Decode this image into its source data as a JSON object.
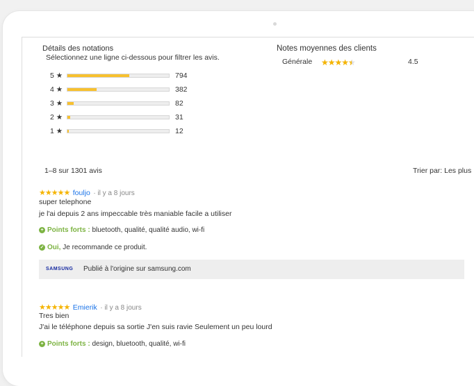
{
  "ratings": {
    "title": "Détails des notations",
    "subtitle": "Sélectionnez une ligne ci-dessous pour filtrer les avis.",
    "star_glyph": "★",
    "rows": [
      {
        "stars": "5",
        "count": "794",
        "fraction": 0.61
      },
      {
        "stars": "4",
        "count": "382",
        "fraction": 0.29
      },
      {
        "stars": "3",
        "count": "82",
        "fraction": 0.065
      },
      {
        "stars": "2",
        "count": "31",
        "fraction": 0.025
      },
      {
        "stars": "1",
        "count": "12",
        "fraction": 0.01
      }
    ]
  },
  "averages": {
    "title": "Notes moyennes des clients",
    "label": "Générale",
    "stars": "★★★★★",
    "value": "4.5",
    "rating": 4.5
  },
  "reviews_meta": {
    "count_text": "1–8 sur 1301 avis",
    "sort_text": "Trier par: Les plus"
  },
  "reviews": [
    {
      "stars": "★★★★★",
      "author": "fouljo",
      "time": "· il y a 8 jours",
      "title": "super telephone",
      "body": "je l'ai depuis 2 ans impeccable très maniable facile a utiliser",
      "pros_label": "Points forts :",
      "pros": "bluetooth,  qualité,  qualité audio,  wi-fi",
      "recommend_yes": "Oui,",
      "recommend_text": "Je recommande ce produit.",
      "brand": "SAMSUNG",
      "source_text": "Publié à l'origine sur samsung.com"
    },
    {
      "stars": "★★★★★",
      "author": "Emierik",
      "time": "· il y a 8 jours",
      "title": "Tres bien",
      "body": "J'ai le téléphone depuis sa sortie J'en suis ravie Seulement un peu lourd",
      "pros_label": "Points forts :",
      "pros": "design,  bluetooth,  qualité,  wi-fi"
    }
  ],
  "colors": {
    "accent_star": "#f5b400",
    "bar_fill": "#f8c12f",
    "link": "#1a73e8",
    "green": "#7cb342"
  }
}
